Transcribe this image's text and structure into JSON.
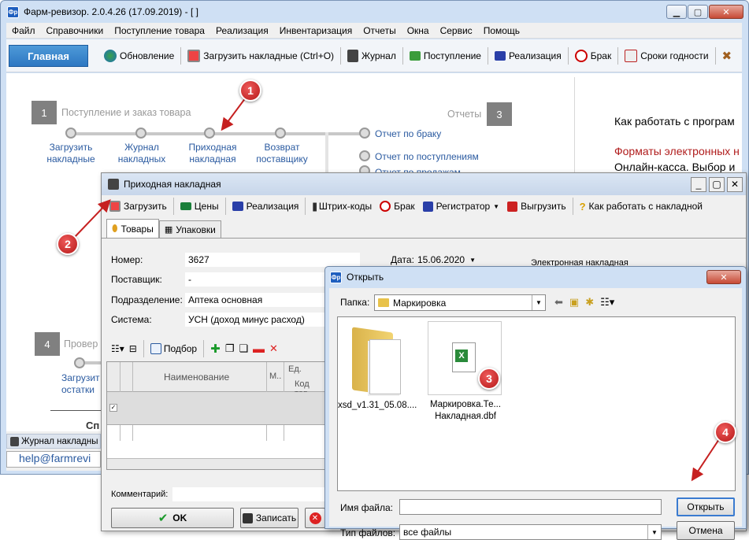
{
  "main_window": {
    "title": "Фарм-ревизор. 2.0.4.26 (17.09.2019) - [ ]",
    "menu": [
      "Файл",
      "Справочники",
      "Поступление товара",
      "Реализация",
      "Инвентаризация",
      "Отчеты",
      "Окна",
      "Сервис",
      "Помощь"
    ],
    "toolbar": {
      "home": "Главная",
      "items": [
        "Обновление",
        "Загрузить накладные (Ctrl+O)",
        "Журнал",
        "Поступление",
        "Реализация",
        "Брак",
        "Сроки годности"
      ]
    },
    "workflow": {
      "step1_num": "1",
      "step1_label": "Поступление и заказ товара",
      "nodes": [
        {
          "label_line1": "Загрузить",
          "label_line2": "накладные"
        },
        {
          "label_line1": "Журнал",
          "label_line2": "накладных"
        },
        {
          "label_line1": "Приходная",
          "label_line2": "накладная"
        },
        {
          "label_line1": "Возврат",
          "label_line2": "поставщику"
        }
      ],
      "step3_num": "3",
      "step3_label": "Отчеты",
      "reports": [
        "Отчет по браку",
        "Отчет по поступлениям",
        "Отчет по продажам"
      ],
      "step4_num": "4",
      "step4_label": "Провер",
      "step4_node_l1": "Загрузит",
      "step4_node_l2": "остатки",
      "sp_text": "Сп"
    },
    "right_panel": {
      "line1": "Как работать с програм",
      "line2": "Форматы электронных н",
      "line3": "Онлайн-касса. Выбор и"
    },
    "status": {
      "journal_tab": "Журнал накладны",
      "email": "help@farmrevi"
    }
  },
  "invoice_dialog": {
    "title": "Приходная накладная",
    "toolbar": [
      "Загрузить",
      "Цены",
      "Реализация",
      "Штрих-коды",
      "Брак",
      "Регистратор",
      "Выгрузить",
      "Как работать с накладной"
    ],
    "tabs": [
      "Товары",
      "Упаковки"
    ],
    "fields": {
      "number_label": "Номер:",
      "number_value": "3627",
      "supplier_label": "Поставщик:",
      "supplier_value": "-",
      "division_label": "Подразделение:",
      "division_value": "Аптека основная",
      "system_label": "Система:",
      "system_value": "УСН (доход минус расход)",
      "date_label": "Дата:",
      "date_value": "15.06.2020",
      "einvoice_label": "Электронная накладная"
    },
    "grid_toolbar": {
      "select_label": "Подбор"
    },
    "grid_headers": {
      "name": "Наименование",
      "m": "М..",
      "unit": "Ед.",
      "code": "Код тов"
    },
    "comment_label": "Комментарий:",
    "ok_label": "OK",
    "save_label": "Записать"
  },
  "open_dialog": {
    "title": "Открыть",
    "folder_label": "Папка:",
    "folder_value": "Маркировка",
    "files": [
      {
        "name": "xsd_v1.31_05.08...."
      },
      {
        "name_l1": "Маркировка.Те...",
        "name_l2": "Накладная.dbf"
      }
    ],
    "filename_label": "Имя файла:",
    "filename_value": "",
    "filetype_label": "Тип файлов:",
    "filetype_value": "все файлы",
    "open_label": "Открыть",
    "cancel_label": "Отмена"
  },
  "markers": [
    "1",
    "2",
    "3",
    "4"
  ],
  "colors": {
    "marker_red": "#c62020",
    "link_blue": "#2a5aa0",
    "accent_red": "#b01c1c",
    "home_blue": "#2d77c2"
  }
}
